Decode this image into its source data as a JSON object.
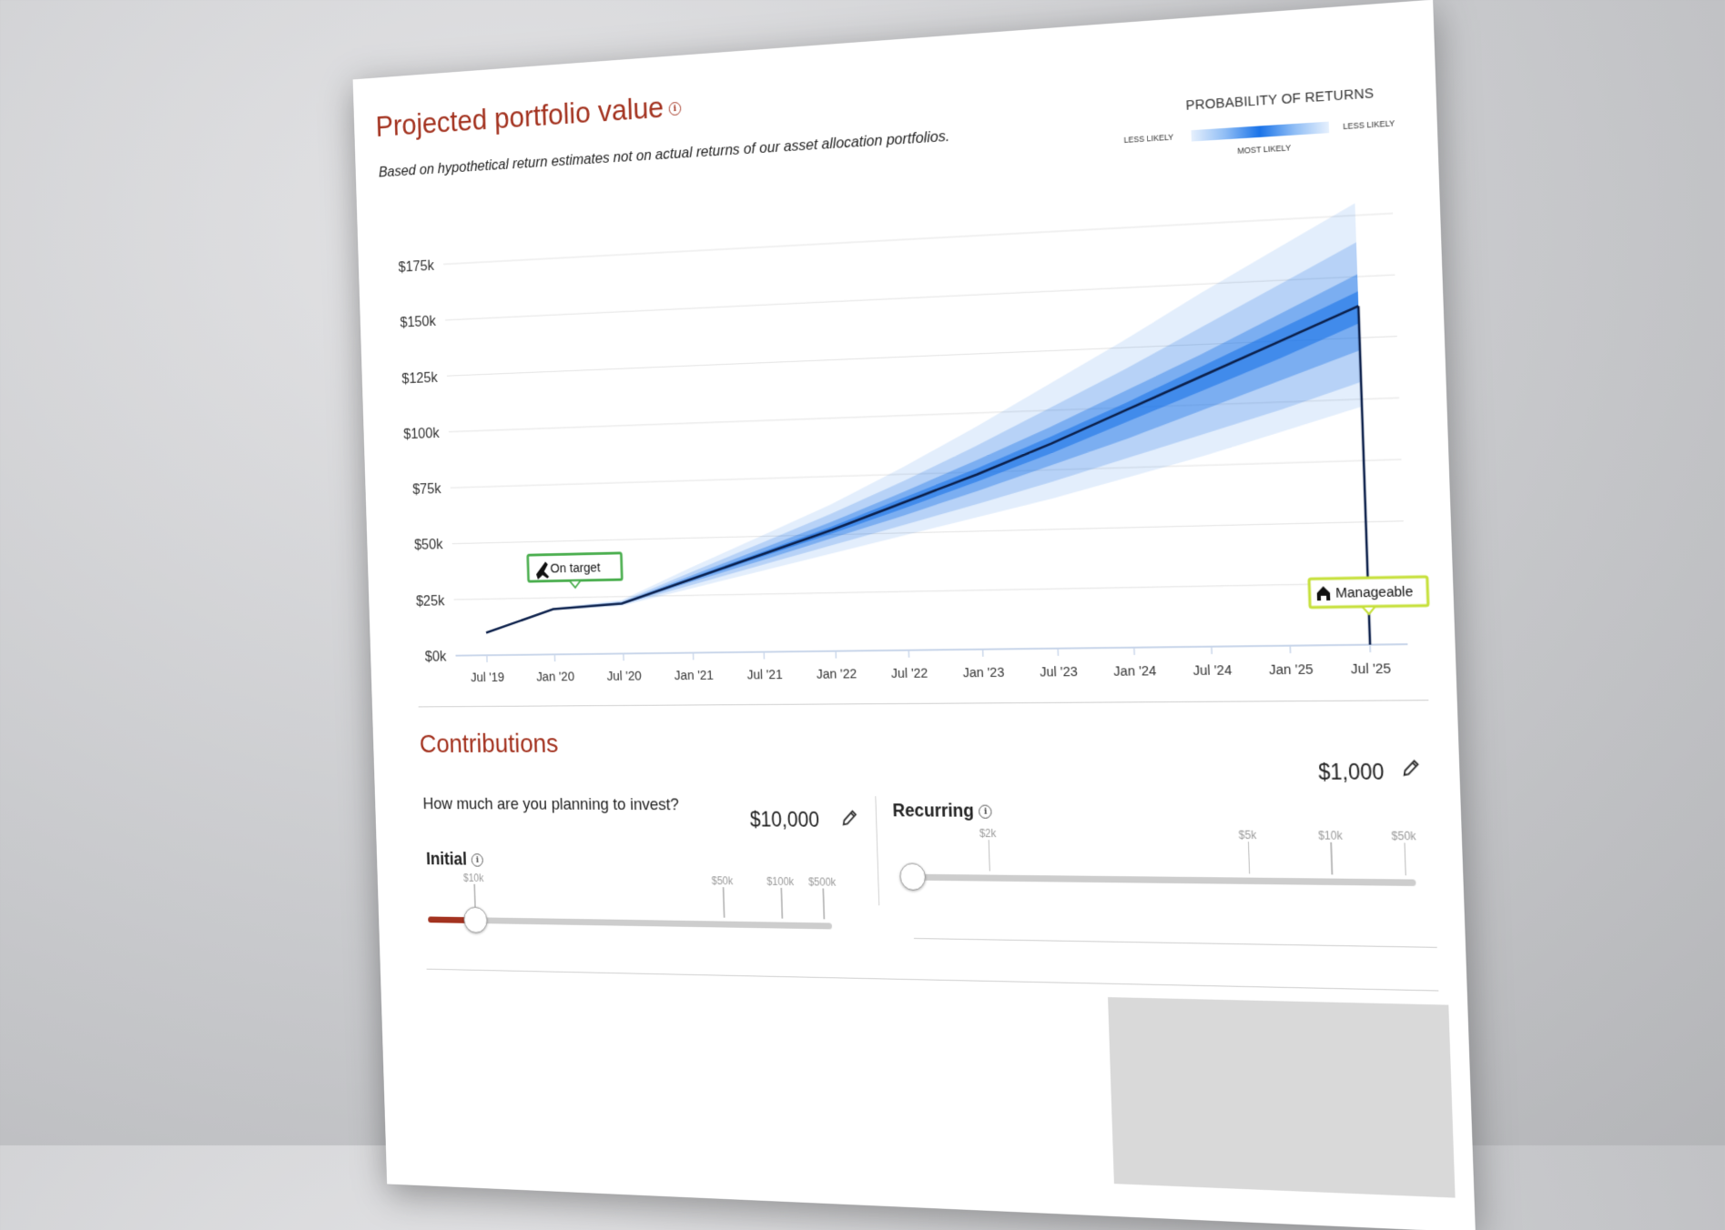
{
  "header": {
    "title": "Projected portfolio value",
    "subtitle": "Based on hypothetical return estimates not on actual returns of our asset allocation portfolios."
  },
  "legend": {
    "title": "PROBABILITY OF RETURNS",
    "less_likely_left": "LESS LIKELY",
    "most_likely": "MOST LIKELY",
    "less_likely_right": "LESS LIKELY"
  },
  "chart_data": {
    "type": "area",
    "x": [
      "Jul '19",
      "Jan '20",
      "Jul '20",
      "Jan '21",
      "Jul '21",
      "Jan '22",
      "Jul '22",
      "Jan '23",
      "Jul '23",
      "Jan '24",
      "Jul '24",
      "Jan '25",
      "Jul '25"
    ],
    "y_ticks": [
      "$0k",
      "$25k",
      "$50k",
      "$75k",
      "$100k",
      "$125k",
      "$150k",
      "$175k"
    ],
    "ylim": [
      0,
      175000
    ],
    "median": [
      10000,
      20000,
      22000,
      32000,
      42000,
      52000,
      63000,
      74000,
      86000,
      99000,
      112000,
      125000,
      138000
    ],
    "bands": [
      {
        "low": [
          10000,
          19500,
          21000,
          28000,
          35000,
          42000,
          49000,
          56000,
          63000,
          71000,
          79000,
          88000,
          97000
        ],
        "high": [
          10000,
          20500,
          23500,
          37000,
          50000,
          63000,
          78000,
          94000,
          111000,
          128000,
          146000,
          163000,
          180000
        ]
      },
      {
        "low": [
          10000,
          19700,
          21400,
          29500,
          37500,
          45500,
          53500,
          61500,
          70000,
          79000,
          88000,
          97000,
          107000
        ],
        "high": [
          10000,
          20300,
          22900,
          35000,
          47000,
          59000,
          72000,
          86000,
          101000,
          116000,
          132000,
          148000,
          164000
        ]
      },
      {
        "low": [
          10000,
          19800,
          21700,
          30800,
          39500,
          48500,
          57500,
          67000,
          77000,
          87000,
          98000,
          109000,
          120000
        ],
        "high": [
          10000,
          20200,
          22500,
          33500,
          44500,
          55500,
          67500,
          80000,
          93000,
          107000,
          121000,
          136000,
          151000
        ]
      },
      {
        "low": [
          10000,
          19900,
          21900,
          31500,
          41000,
          50500,
          60500,
          71000,
          82000,
          94000,
          106000,
          118000,
          131000
        ],
        "high": [
          10000,
          20100,
          22200,
          32700,
          43000,
          53500,
          65000,
          76500,
          89000,
          102000,
          116000,
          130000,
          144000
        ]
      }
    ],
    "annotations": [
      {
        "label": "On target",
        "x_index": 1,
        "icon": "airplane-icon",
        "color": "#4caf50"
      },
      {
        "label": "Manageable",
        "x_index": 12,
        "icon": "house-icon",
        "color": "#c6e03a"
      }
    ],
    "colors": {
      "median": "#0b1f4a",
      "band": "#1a73e8",
      "grid": "#e3e3e3"
    }
  },
  "contributions": {
    "title": "Contributions",
    "question": "How much are you planning to invest?",
    "initial": {
      "label": "Initial",
      "amount": "$10,000",
      "level": 0.12,
      "ticks": [
        {
          "label": "$10k",
          "pos": 0.12
        },
        {
          "label": "$50k",
          "pos": 0.74
        },
        {
          "label": "$100k",
          "pos": 0.88
        },
        {
          "label": "$500k",
          "pos": 0.98
        }
      ]
    },
    "recurring": {
      "label": "Recurring",
      "amount": "$1,000",
      "level": 0.0,
      "ticks": [
        {
          "label": "$2k",
          "pos": 0.16
        },
        {
          "label": "$5k",
          "pos": 0.68
        },
        {
          "label": "$10k",
          "pos": 0.84
        },
        {
          "label": "$50k",
          "pos": 0.98
        }
      ]
    }
  },
  "colors": {
    "accent": "#a3321f"
  }
}
